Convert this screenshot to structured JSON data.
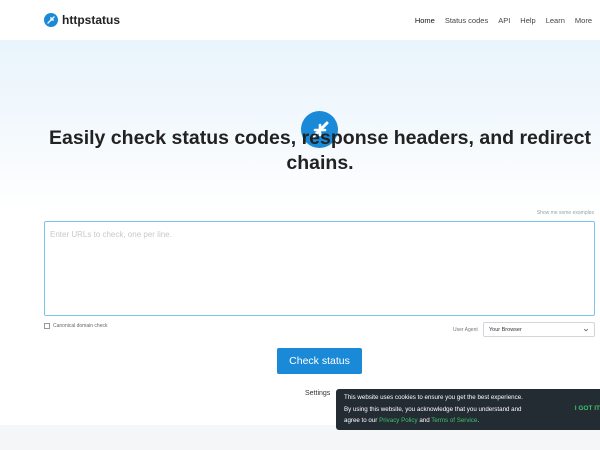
{
  "header": {
    "brand_name": "httpstatus",
    "nav": [
      "Home",
      "Status codes",
      "API",
      "Help",
      "Learn",
      "More"
    ]
  },
  "hero": {
    "headline_pre": "Easily check ",
    "headline_b1": "status codes",
    "headline_sep1": ", ",
    "headline_b2": "response headers",
    "headline_sep2": ", and ",
    "headline_b3": "redirect chains",
    "headline_end": "."
  },
  "form": {
    "example_link": "Show me some examples",
    "urls_placeholder": "Enter URLs to check, one per line.",
    "canonical_label": "Canonical domain check",
    "canonical_checked": false,
    "user_agent_label": "User Agent",
    "user_agent_value": "Your Browser",
    "submit_label": "Check status",
    "settings_label": "Settings"
  },
  "cookie_banner": {
    "line1": "This website uses cookies to ensure you get the best experience.",
    "line2": "By using this website, you acknowledge that you understand and",
    "line3_pre": "agree to our ",
    "privacy_link": "Privacy Policy",
    "line3_mid": " and ",
    "terms_link": "Terms of Service",
    "line3_end": ".",
    "accept_label": "I GOT IT"
  },
  "colors": {
    "brand": "#1a8ad8",
    "banner_bg": "#232b33",
    "banner_link": "#3fc36a"
  },
  "icons": {
    "brand": "httpstatus-logo-icon",
    "hero": "redirect-arrows-icon",
    "select": "chevron-down-icon"
  }
}
